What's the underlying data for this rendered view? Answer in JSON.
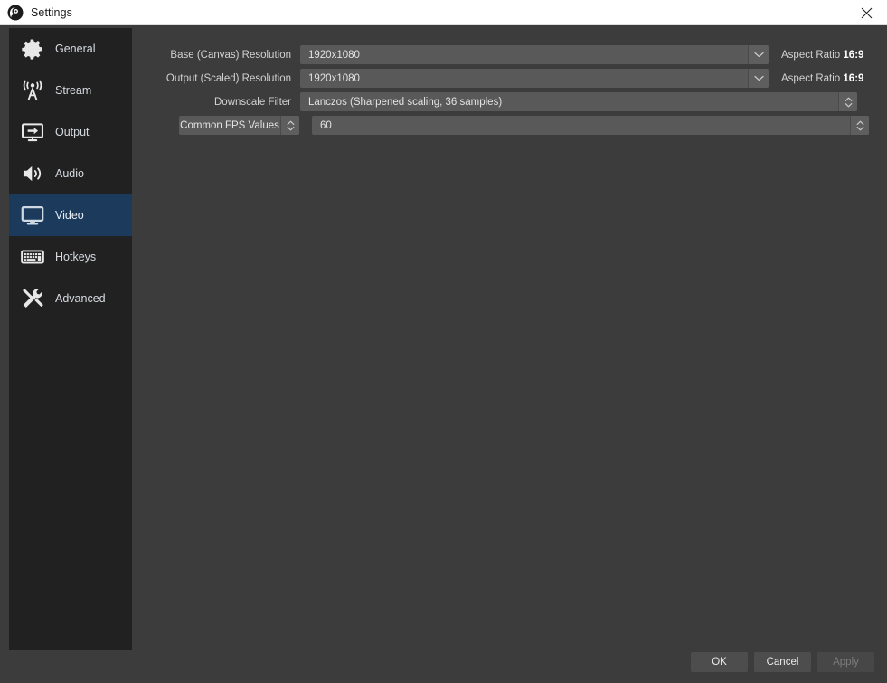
{
  "window": {
    "title": "Settings",
    "logo_icon": "obs-logo-icon",
    "close_icon": "close-icon"
  },
  "sidebar": {
    "items": [
      {
        "label": "General",
        "icon": "gear-icon",
        "selected": false
      },
      {
        "label": "Stream",
        "icon": "broadcast-icon",
        "selected": false
      },
      {
        "label": "Output",
        "icon": "monitor-arrow-icon",
        "selected": false
      },
      {
        "label": "Audio",
        "icon": "speaker-icon",
        "selected": false
      },
      {
        "label": "Video",
        "icon": "monitor-icon",
        "selected": true
      },
      {
        "label": "Hotkeys",
        "icon": "keyboard-icon",
        "selected": false
      },
      {
        "label": "Advanced",
        "icon": "tools-icon",
        "selected": false
      }
    ]
  },
  "video_settings": {
    "base_resolution": {
      "label": "Base (Canvas) Resolution",
      "value": "1920x1080",
      "aspect_label": "Aspect Ratio",
      "aspect_value": "16:9",
      "dropdown_icon": "chevron-down-icon"
    },
    "output_resolution": {
      "label": "Output (Scaled) Resolution",
      "value": "1920x1080",
      "aspect_label": "Aspect Ratio",
      "aspect_value": "16:9",
      "dropdown_icon": "chevron-down-icon"
    },
    "downscale_filter": {
      "label": "Downscale Filter",
      "value": "Lanczos (Sharpened scaling, 36 samples)",
      "spinner_icon": "spinner-updown-icon"
    },
    "fps": {
      "mode_label": "Common FPS Values",
      "mode_spinner_icon": "spinner-updown-icon",
      "value": "60",
      "value_spinner_icon": "spinner-updown-icon"
    }
  },
  "footer": {
    "ok_label": "OK",
    "cancel_label": "Cancel",
    "apply_label": "Apply",
    "apply_enabled": false
  },
  "colors": {
    "window_bg": "#3c3c3c",
    "sidebar_bg": "#212121",
    "selection_blue": "#1b3a5c",
    "field_bg": "#595959",
    "titlebar_bg": "#ffffff"
  }
}
